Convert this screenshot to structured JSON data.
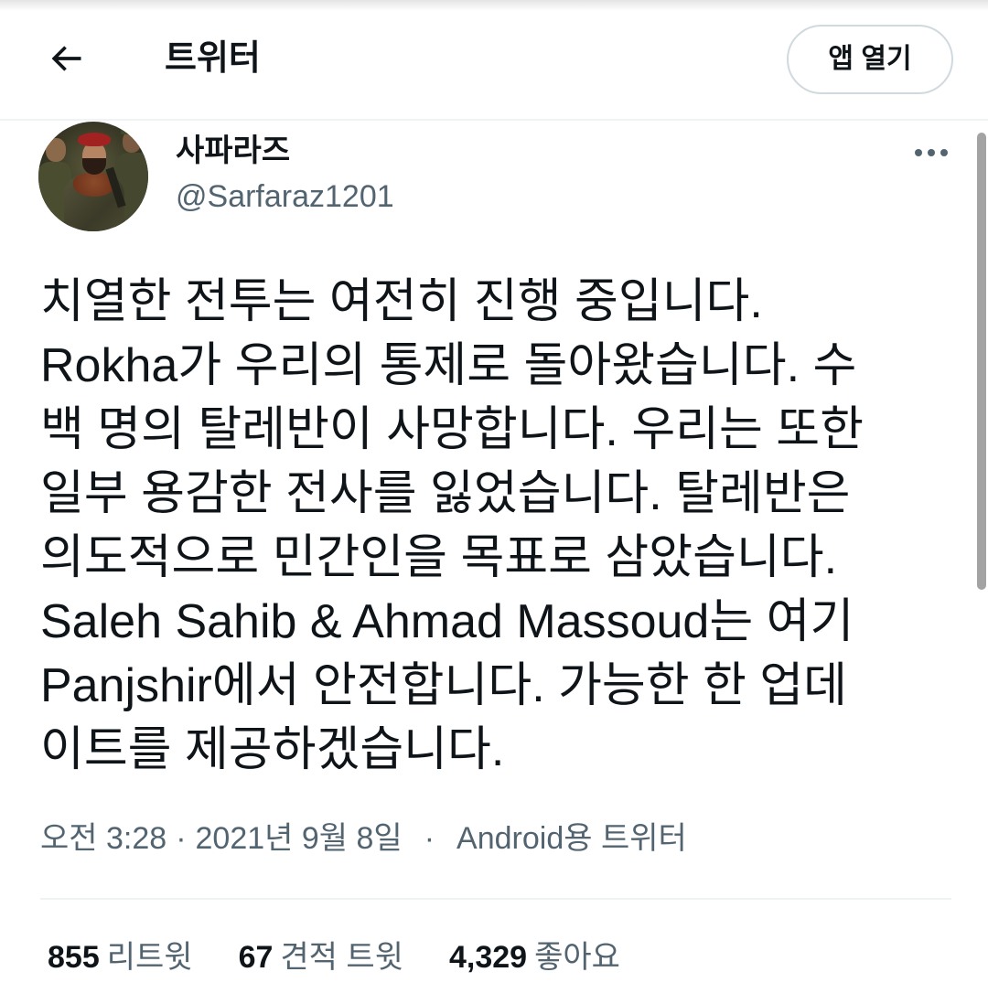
{
  "header": {
    "title": "트위터",
    "open_app_label": "앱 열기"
  },
  "icons": {
    "back": "back-arrow-icon",
    "more": "more-icon"
  },
  "colors": {
    "text": "#0f1419",
    "secondary": "#536471",
    "divider": "#eff3f4",
    "button_border": "#cfd9de",
    "scrollbar": "#a3a3a3"
  },
  "tweet": {
    "author": {
      "display_name": "사파라즈",
      "handle": "@Sarfaraz1201"
    },
    "lines": [
      "치열한 전투는 여전히 진행 중입니다.",
      "Rokha가 우리의 통제로 돌아왔습니다. 수",
      "백 명의 탈레반이 사망합니다. 우리는 또한",
      "일부 용감한 전사를 잃었습니다. 탈레반은",
      "의도적으로 민간인을 목표로 삼았습니다.",
      "Saleh Sahib & Ahmad Massoud는 여기",
      "Panjshir에서 안전합니다. 가능한 한 업데",
      "이트를 제공하겠습니다."
    ],
    "meta": {
      "time": "오전 3:28",
      "separator": "·",
      "date": "2021년 9월 8일",
      "source": "Android용 트위터"
    },
    "stats": [
      {
        "count": "855",
        "label": "리트윗"
      },
      {
        "count": "67",
        "label": "견적 트윗"
      },
      {
        "count": "4,329",
        "label": "좋아요"
      }
    ]
  }
}
